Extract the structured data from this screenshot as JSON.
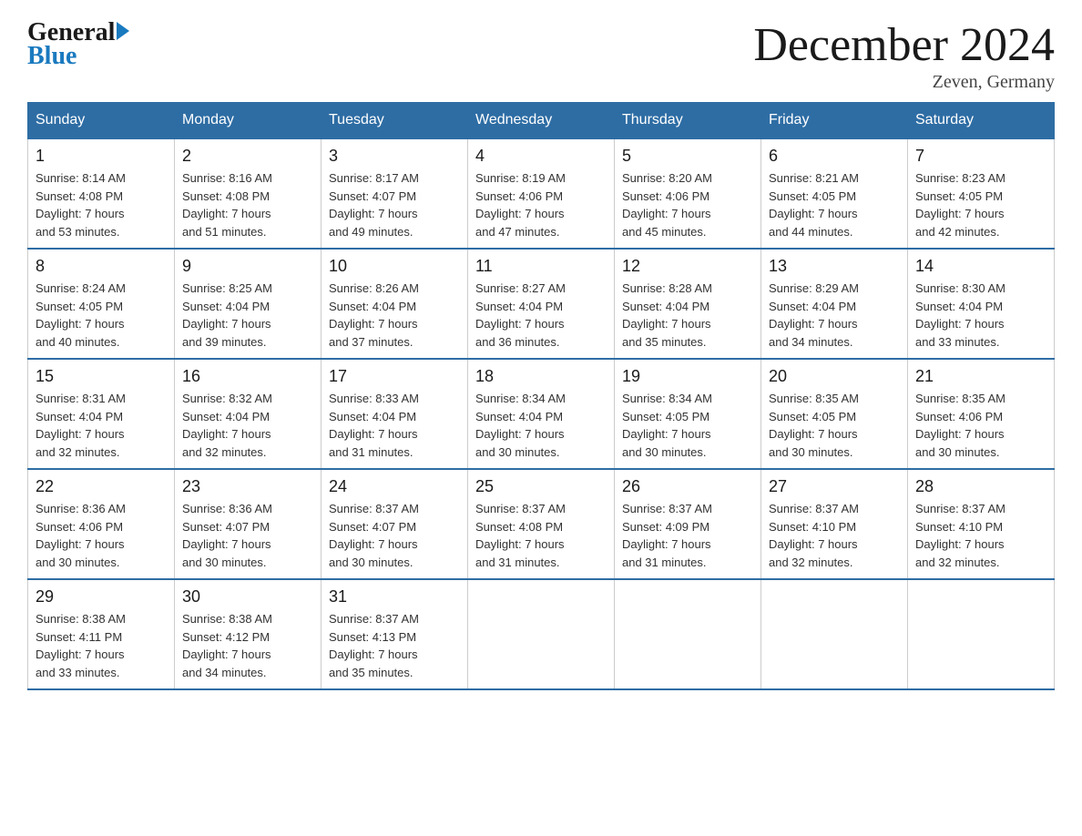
{
  "header": {
    "logo_general": "General",
    "logo_blue": "Blue",
    "month_title": "December 2024",
    "location": "Zeven, Germany"
  },
  "days_of_week": [
    "Sunday",
    "Monday",
    "Tuesday",
    "Wednesday",
    "Thursday",
    "Friday",
    "Saturday"
  ],
  "weeks": [
    [
      {
        "day": "1",
        "sunrise": "8:14 AM",
        "sunset": "4:08 PM",
        "daylight": "7 hours and 53 minutes."
      },
      {
        "day": "2",
        "sunrise": "8:16 AM",
        "sunset": "4:08 PM",
        "daylight": "7 hours and 51 minutes."
      },
      {
        "day": "3",
        "sunrise": "8:17 AM",
        "sunset": "4:07 PM",
        "daylight": "7 hours and 49 minutes."
      },
      {
        "day": "4",
        "sunrise": "8:19 AM",
        "sunset": "4:06 PM",
        "daylight": "7 hours and 47 minutes."
      },
      {
        "day": "5",
        "sunrise": "8:20 AM",
        "sunset": "4:06 PM",
        "daylight": "7 hours and 45 minutes."
      },
      {
        "day": "6",
        "sunrise": "8:21 AM",
        "sunset": "4:05 PM",
        "daylight": "7 hours and 44 minutes."
      },
      {
        "day": "7",
        "sunrise": "8:23 AM",
        "sunset": "4:05 PM",
        "daylight": "7 hours and 42 minutes."
      }
    ],
    [
      {
        "day": "8",
        "sunrise": "8:24 AM",
        "sunset": "4:05 PM",
        "daylight": "7 hours and 40 minutes."
      },
      {
        "day": "9",
        "sunrise": "8:25 AM",
        "sunset": "4:04 PM",
        "daylight": "7 hours and 39 minutes."
      },
      {
        "day": "10",
        "sunrise": "8:26 AM",
        "sunset": "4:04 PM",
        "daylight": "7 hours and 37 minutes."
      },
      {
        "day": "11",
        "sunrise": "8:27 AM",
        "sunset": "4:04 PM",
        "daylight": "7 hours and 36 minutes."
      },
      {
        "day": "12",
        "sunrise": "8:28 AM",
        "sunset": "4:04 PM",
        "daylight": "7 hours and 35 minutes."
      },
      {
        "day": "13",
        "sunrise": "8:29 AM",
        "sunset": "4:04 PM",
        "daylight": "7 hours and 34 minutes."
      },
      {
        "day": "14",
        "sunrise": "8:30 AM",
        "sunset": "4:04 PM",
        "daylight": "7 hours and 33 minutes."
      }
    ],
    [
      {
        "day": "15",
        "sunrise": "8:31 AM",
        "sunset": "4:04 PM",
        "daylight": "7 hours and 32 minutes."
      },
      {
        "day": "16",
        "sunrise": "8:32 AM",
        "sunset": "4:04 PM",
        "daylight": "7 hours and 32 minutes."
      },
      {
        "day": "17",
        "sunrise": "8:33 AM",
        "sunset": "4:04 PM",
        "daylight": "7 hours and 31 minutes."
      },
      {
        "day": "18",
        "sunrise": "8:34 AM",
        "sunset": "4:04 PM",
        "daylight": "7 hours and 30 minutes."
      },
      {
        "day": "19",
        "sunrise": "8:34 AM",
        "sunset": "4:05 PM",
        "daylight": "7 hours and 30 minutes."
      },
      {
        "day": "20",
        "sunrise": "8:35 AM",
        "sunset": "4:05 PM",
        "daylight": "7 hours and 30 minutes."
      },
      {
        "day": "21",
        "sunrise": "8:35 AM",
        "sunset": "4:06 PM",
        "daylight": "7 hours and 30 minutes."
      }
    ],
    [
      {
        "day": "22",
        "sunrise": "8:36 AM",
        "sunset": "4:06 PM",
        "daylight": "7 hours and 30 minutes."
      },
      {
        "day": "23",
        "sunrise": "8:36 AM",
        "sunset": "4:07 PM",
        "daylight": "7 hours and 30 minutes."
      },
      {
        "day": "24",
        "sunrise": "8:37 AM",
        "sunset": "4:07 PM",
        "daylight": "7 hours and 30 minutes."
      },
      {
        "day": "25",
        "sunrise": "8:37 AM",
        "sunset": "4:08 PM",
        "daylight": "7 hours and 31 minutes."
      },
      {
        "day": "26",
        "sunrise": "8:37 AM",
        "sunset": "4:09 PM",
        "daylight": "7 hours and 31 minutes."
      },
      {
        "day": "27",
        "sunrise": "8:37 AM",
        "sunset": "4:10 PM",
        "daylight": "7 hours and 32 minutes."
      },
      {
        "day": "28",
        "sunrise": "8:37 AM",
        "sunset": "4:10 PM",
        "daylight": "7 hours and 32 minutes."
      }
    ],
    [
      {
        "day": "29",
        "sunrise": "8:38 AM",
        "sunset": "4:11 PM",
        "daylight": "7 hours and 33 minutes."
      },
      {
        "day": "30",
        "sunrise": "8:38 AM",
        "sunset": "4:12 PM",
        "daylight": "7 hours and 34 minutes."
      },
      {
        "day": "31",
        "sunrise": "8:37 AM",
        "sunset": "4:13 PM",
        "daylight": "7 hours and 35 minutes."
      },
      null,
      null,
      null,
      null
    ]
  ],
  "labels": {
    "sunrise": "Sunrise:",
    "sunset": "Sunset:",
    "daylight": "Daylight:"
  }
}
